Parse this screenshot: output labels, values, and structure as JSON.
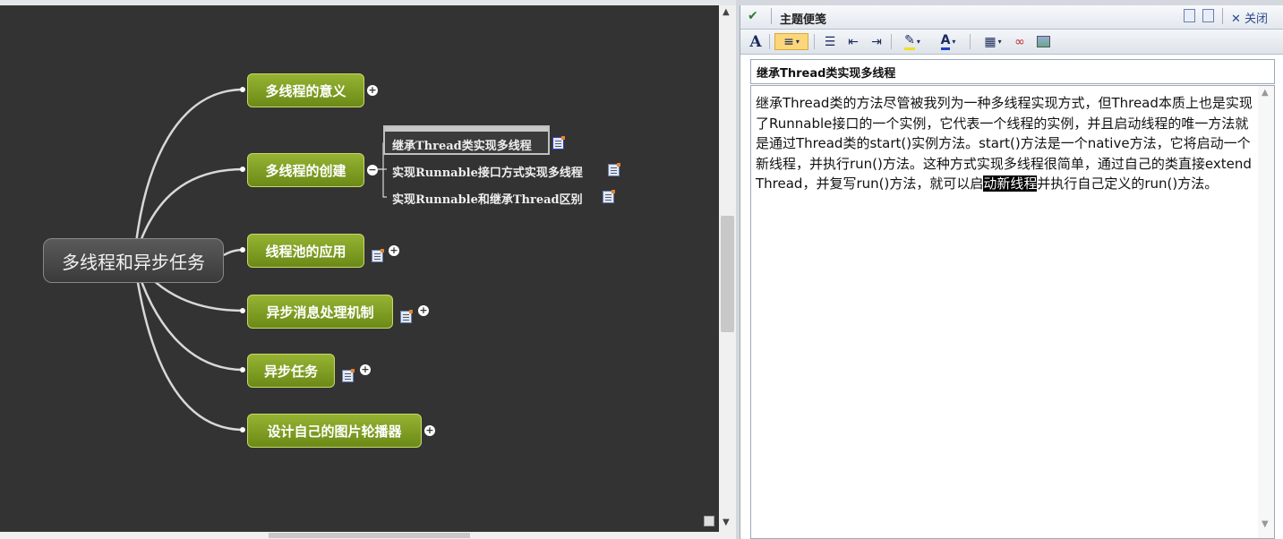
{
  "mindmap": {
    "central_topic": "多线程和异步任务",
    "topics": [
      {
        "label": "多线程的意义"
      },
      {
        "label": "多线程的创建"
      },
      {
        "label": "线程池的应用"
      },
      {
        "label": "异步消息处理机制"
      },
      {
        "label": "异步任务"
      },
      {
        "label": "设计自己的图片轮播器"
      }
    ],
    "subtopics": [
      {
        "label": "继承Thread类实现多线程"
      },
      {
        "label": "实现Runnable接口方式实现多线程"
      },
      {
        "label": "实现Runnable和继承Thread区别"
      }
    ]
  },
  "panel": {
    "title": "主题便笺",
    "close_label": "关闭",
    "note_title": "继承Thread类实现多线程",
    "note_text_before": "继承Thread类的方法尽管被我列为一种多线程实现方式，但Thread本质上也是实现了Runnable接口的一个实例，它代表一个线程的实例，并且启动线程的唯一方法就是通过Thread类的start()实例方法。start()方法是一个native方法，它将启动一个新线程，并执行run()方法。这种方式实现多线程很简单，通过自己的类直接extend Thread，并复写run()方法，就可以启",
    "note_text_highlight": "动新线程",
    "note_text_after": "并执行自己定义的run()方法。"
  },
  "toolbar": {
    "font_label": "A",
    "font_color_label": "A"
  }
}
